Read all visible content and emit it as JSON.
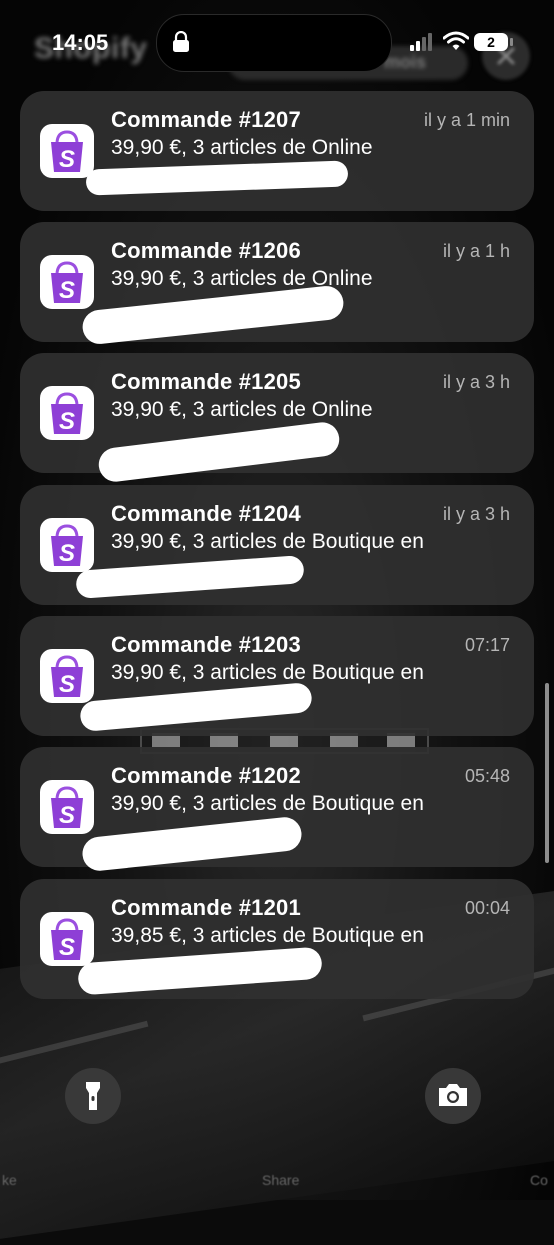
{
  "status_bar": {
    "time": "14:05",
    "battery_badge": "2",
    "icons": [
      "lock-icon",
      "cellular-signal-icon",
      "wifi-icon",
      "battery-icon"
    ]
  },
  "background_header": {
    "app_name": "Shopify",
    "pill_text": "mois"
  },
  "notifications": [
    {
      "title": "Commande #1207",
      "time": "il y a 1 min",
      "body": "39,90 €, 3 articles de Online"
    },
    {
      "title": "Commande #1206",
      "time": "il y a 1 h",
      "body": "39,90 €, 3 articles de Online"
    },
    {
      "title": "Commande #1205",
      "time": "il y a 3 h",
      "body": "39,90 €, 3 articles de Online"
    },
    {
      "title": "Commande #1204",
      "time": "il y a 3 h",
      "body": "39,90 €, 3 articles de Boutique en"
    },
    {
      "title": "Commande #1203",
      "time": "07:17",
      "body": "39,90 €, 3 articles de Boutique en"
    },
    {
      "title": "Commande #1202",
      "time": "05:48",
      "body": "39,90 €, 3 articles de Boutique en"
    },
    {
      "title": "Commande #1201",
      "time": "00:04",
      "body": "39,85 €, 3 articles de Boutique en"
    }
  ],
  "app_icon": "shopify-bag-icon",
  "bottom_bar": {
    "left_button_icon": "flashlight-icon",
    "right_button_icon": "camera-icon",
    "labels": [
      "ke",
      "Share",
      "Co"
    ]
  },
  "colors": {
    "card": "#303030",
    "app_icon_purple": "#8e3fd6",
    "time_text": "#b5b5b5"
  }
}
